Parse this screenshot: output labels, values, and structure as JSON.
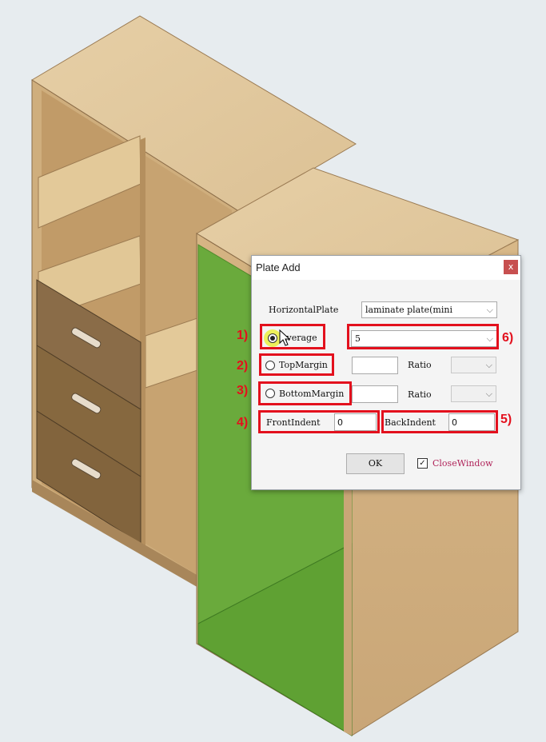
{
  "dialog": {
    "title": "Plate Add",
    "close_glyph": "x",
    "horizontal_plate_label": "HorizontalPlate",
    "horizontal_plate_value": "laminate plate(mini",
    "average_label": "Average",
    "average_value": "5",
    "top_margin_label": "TopMargin",
    "top_margin_value": "",
    "bottom_margin_label": "BottomMargin",
    "bottom_margin_value": "",
    "ratio_label": "Ratio",
    "ratio_label_2": "Ratio",
    "front_indent_label": "FrontIndent",
    "front_indent_value": "0",
    "back_indent_label": "BackIndent",
    "back_indent_value": "0",
    "ok_label": "OK",
    "close_window_label": "CloseWindow",
    "close_window_checked": true,
    "selected_mode": "Average"
  },
  "annotations": {
    "n1": "1)",
    "n2": "2)",
    "n3": "3)",
    "n4": "4)",
    "n5": "5)",
    "n6": "6)",
    "color": "#e3101d"
  },
  "scene": {
    "background": "#e7ecef",
    "wood": "#d9b98a",
    "drawer": "#8a6c48",
    "green_panel": "#6aaa3c",
    "arrow_icon": "chevron-down-icon",
    "check_icon": "checkmark-icon"
  }
}
